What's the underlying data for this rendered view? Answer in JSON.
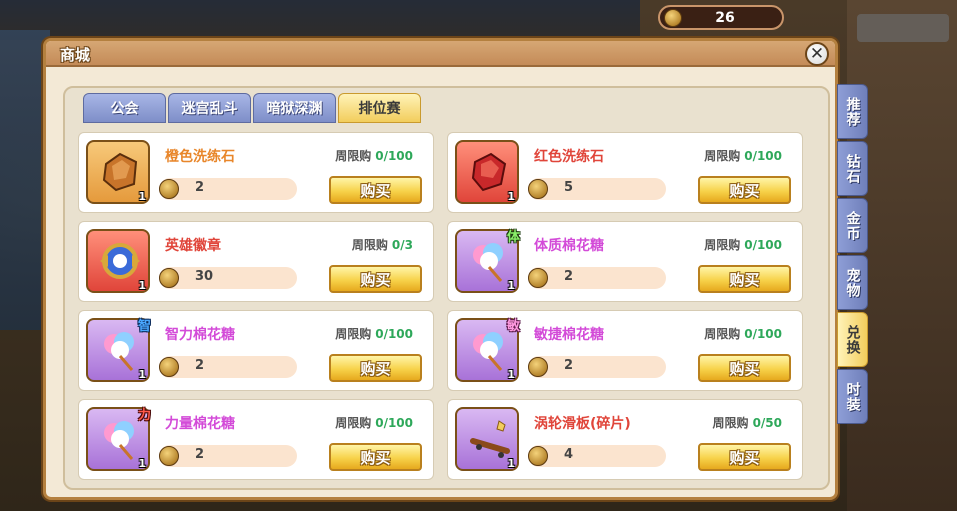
{
  "header": {
    "gold": "26"
  },
  "dialog": {
    "title": "商城",
    "close_symbol": "✕"
  },
  "tabs": [
    {
      "label": "公会",
      "active": false
    },
    {
      "label": "迷宫乱斗",
      "active": false
    },
    {
      "label": "暗狱深渊",
      "active": false
    },
    {
      "label": "排位赛",
      "active": true
    }
  ],
  "side_tabs": [
    {
      "label": "推荐",
      "active": false
    },
    {
      "label": "钻石",
      "active": false
    },
    {
      "label": "金币",
      "active": false
    },
    {
      "label": "宠物",
      "active": false
    },
    {
      "label": "兑换",
      "active": true
    },
    {
      "label": "时装",
      "active": false
    }
  ],
  "items": [
    {
      "name": "橙色洗练石",
      "limit_label": "周限购",
      "limit": "0/100",
      "price": "2",
      "count": "1",
      "buy_label": "购买",
      "icon": "orange-stone-icon",
      "tag": ""
    },
    {
      "name": "红色洗练石",
      "limit_label": "周限购",
      "limit": "0/100",
      "price": "5",
      "count": "1",
      "buy_label": "购买",
      "icon": "red-stone-icon",
      "tag": ""
    },
    {
      "name": "英雄徽章",
      "limit_label": "周限购",
      "limit": "0/3",
      "price": "30",
      "count": "1",
      "buy_label": "购买",
      "icon": "hero-badge-icon",
      "tag": ""
    },
    {
      "name": "体质棉花糖",
      "limit_label": "周限购",
      "limit": "0/100",
      "price": "2",
      "count": "1",
      "buy_label": "购买",
      "icon": "cotton-candy-icon",
      "tag": "体"
    },
    {
      "name": "智力棉花糖",
      "limit_label": "周限购",
      "limit": "0/100",
      "price": "2",
      "count": "1",
      "buy_label": "购买",
      "icon": "cotton-candy-icon",
      "tag": "智"
    },
    {
      "name": "敏捷棉花糖",
      "limit_label": "周限购",
      "limit": "0/100",
      "price": "2",
      "count": "1",
      "buy_label": "购买",
      "icon": "cotton-candy-icon",
      "tag": "敏"
    },
    {
      "name": "力量棉花糖",
      "limit_label": "周限购",
      "limit": "0/100",
      "price": "2",
      "count": "1",
      "buy_label": "购买",
      "icon": "cotton-candy-icon",
      "tag": "力"
    },
    {
      "name": "涡轮滑板(碎片)",
      "limit_label": "周限购",
      "limit": "0/50",
      "price": "4",
      "count": "1",
      "buy_label": "购买",
      "icon": "skateboard-fragment-icon",
      "tag": ""
    }
  ]
}
